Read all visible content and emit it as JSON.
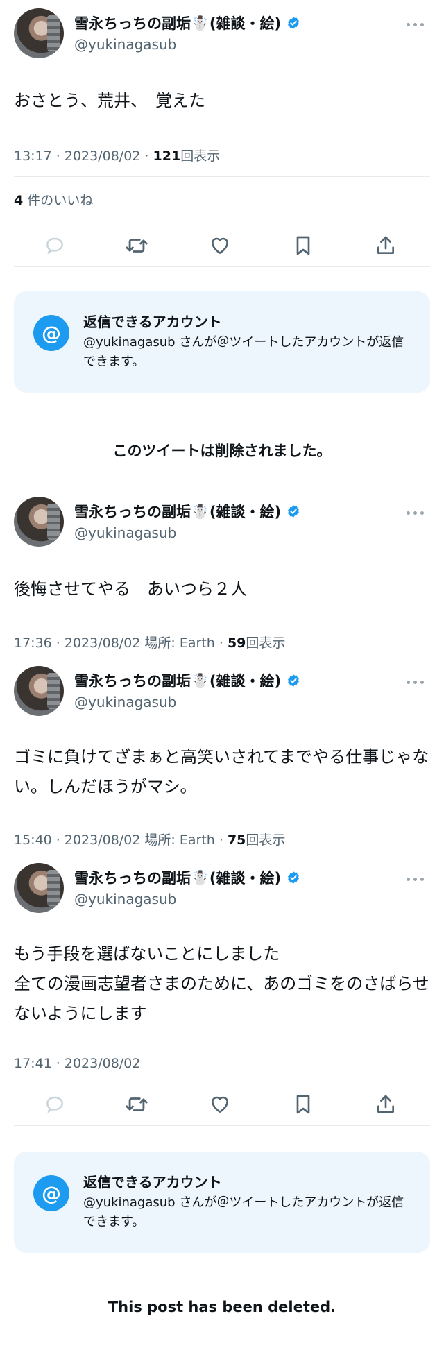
{
  "author": {
    "name": "雪永ちっちの副垢",
    "name_suffix": "(雑談・絵)",
    "snowman": "☃️",
    "handle": "@yukinagasub"
  },
  "tweets": [
    {
      "text": "おさとう、荒井、　覚えた",
      "meta": "13:17 · 2023/08/02 · ",
      "views_count": "121",
      "views_label": "回表示",
      "likes_count": "4",
      "likes_label": "件のいいね"
    },
    {
      "text": "後悔させてやる　あいつら２人",
      "meta": "17:36 · 2023/08/02 場所: Earth · ",
      "views_count": "59",
      "views_label": "回表示"
    },
    {
      "text": "ゴミに負けてざまぁと高笑いされてまでやる仕事じゃない。しんだほうがマシ。",
      "meta": "15:40 · 2023/08/02 場所: Earth · ",
      "views_count": "75",
      "views_label": "回表示"
    },
    {
      "text": "もう手段を選ばないことにしました\n全ての漫画志望者さまのために、あのゴミをのさばらせないようにします",
      "meta": "17:41 · 2023/08/02"
    }
  ],
  "reply_restriction": {
    "title": "返信できるアカウント",
    "description": "@yukinagasub さんが＠ツイートしたアカウントが返信できます。",
    "icon": "@"
  },
  "deleted_notice_jp": "このツイートは削除されました。",
  "deleted_notice_en": "This post has been deleted.",
  "icons": {
    "reply": "reply-icon",
    "retweet": "retweet-icon",
    "like": "heart-icon",
    "bookmark": "bookmark-icon",
    "share": "share-icon",
    "verified": "verified-badge-icon",
    "more": "more-icon"
  },
  "colors": {
    "accent": "#1d9bf0",
    "secondary_text": "#536471",
    "card_background": "#eef6fd"
  }
}
